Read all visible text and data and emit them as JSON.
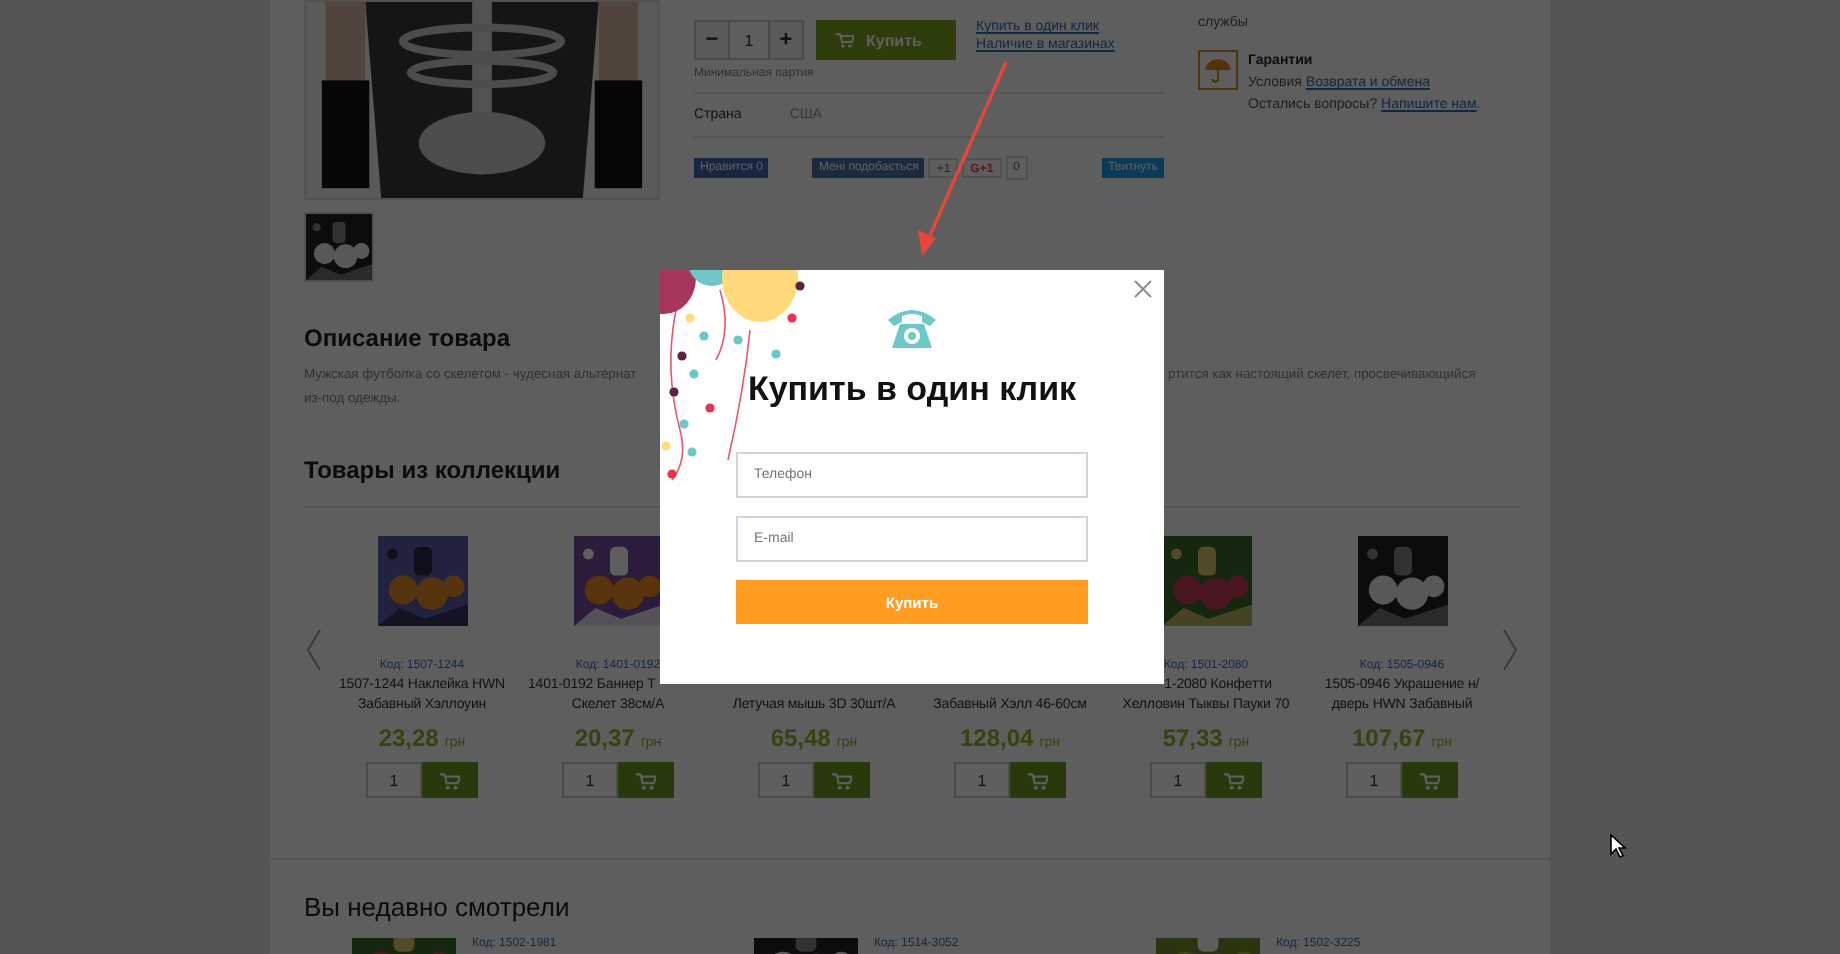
{
  "product": {
    "main_image": {
      "kind": "picture"
    },
    "thumbnail": {
      "kind": "picture"
    },
    "minus": "−",
    "quantity": "1",
    "plus": "+",
    "buy_button": "Купить",
    "min_batch": "Минимальная партия",
    "links": [
      "Купить в один клик",
      "Наличие в магазинах"
    ],
    "attributes": [
      {
        "label": "Страна",
        "value": "США"
      }
    ],
    "social": [
      {
        "kind": "facebook",
        "label": "Нравится 0"
      },
      {
        "kind": "vk",
        "label": "Мені подобається"
      },
      {
        "kind": "plus",
        "label": "+1"
      },
      {
        "kind": "gplus",
        "label": "G+1"
      },
      {
        "kind": "count",
        "label": "0"
      },
      {
        "kind": "twitter",
        "label": "Твитнуть"
      }
    ]
  },
  "info_panel": {
    "delivery_text": "службы",
    "guarantee_title": "Гарантии",
    "guarantee_lines": [
      {
        "text": "Условия",
        "link": "Возврата и обмена"
      },
      {
        "text": "Остались вопросы?",
        "link": "Напишите нам",
        "tail": "."
      }
    ]
  },
  "description": {
    "title": "Описание товара",
    "lines": [
      {
        "left": "Мужская футболка со скелетом - чудесная альтернат",
        "right": "ртится как настоящий скелет, просвечивающийся"
      },
      {
        "left": "из-под одежды."
      }
    ]
  },
  "collection": {
    "title": "Товары из коллекции",
    "products": [
      {
        "image": {
          "kind": "picture"
        },
        "code": "Код: 1507-1244",
        "name_lines": [
          {
            "text": "1507-1244 Наклейка HWN"
          },
          {
            "text": "Забавный Хэллоуин"
          }
        ],
        "price": "23,28",
        "currency": "грн",
        "quantity": "1"
      },
      {
        "image": {
          "kind": "picture"
        },
        "code": "Код: 1401-0192",
        "name_lines": [
          {
            "text": "1401-0192 Баннер Т",
            "cut": true
          },
          {
            "text": "Скелет 38см/А"
          }
        ],
        "price": "20,37",
        "currency": "грн",
        "quantity": "1"
      },
      {
        "name_lines": [
          {
            "text": "Летучая мышь 3D 30шт/А"
          }
        ],
        "price": "65,48",
        "currency": "грн",
        "quantity": "1"
      },
      {
        "name_lines": [
          {
            "text": "Забавный Хэлл 46-60см"
          }
        ],
        "price": "128,04",
        "currency": "грн",
        "quantity": "1"
      },
      {
        "image": {
          "kind": "picture"
        },
        "code": "Код: 1501-2080",
        "name_lines": [
          {
            "text": "1-2080 Конфетти",
            "cut": true
          },
          {
            "text": "Хелловин Тыквы Пауки 70"
          }
        ],
        "price": "57,33",
        "currency": "грн",
        "quantity": "1"
      },
      {
        "image": {
          "kind": "picture"
        },
        "code": "Код: 1505-0946",
        "name_lines": [
          {
            "text": "1505-0946 Украшение н/"
          },
          {
            "text": "дверь HWN Забавный"
          }
        ],
        "price": "107,67",
        "currency": "грн",
        "quantity": "1"
      }
    ]
  },
  "recent": {
    "title": "Вы недавно смотрели",
    "items": [
      {
        "image": {
          "kind": "picture"
        },
        "code": "Код: 1502-1981"
      },
      {
        "image": {
          "kind": "picture"
        },
        "code": "Код: 1514-3052"
      },
      {
        "image": {
          "kind": "picture"
        },
        "code": "Код: 1502-3225"
      }
    ]
  },
  "modal": {
    "title": "Купить в один клик",
    "fields": [
      {
        "placeholder": "Телефон"
      },
      {
        "placeholder": "E-mail"
      }
    ],
    "submit": "Купить"
  }
}
